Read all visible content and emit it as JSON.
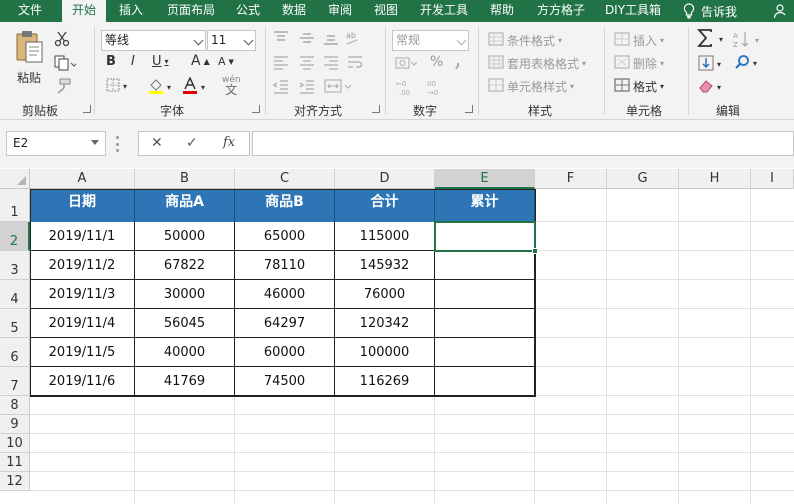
{
  "tabs": [
    "文件",
    "开始",
    "插入",
    "页面布局",
    "公式",
    "数据",
    "审阅",
    "视图",
    "开发工具",
    "帮助",
    "方方格子",
    "DIY工具箱"
  ],
  "tell_me": "告诉我",
  "ribbon": {
    "clipboard": {
      "paste": "粘贴",
      "label": "剪贴板"
    },
    "font": {
      "name": "等线",
      "size": "11",
      "bold": "B",
      "italic": "I",
      "underline": "U",
      "grow": "A",
      "shrink": "A",
      "wen": "wén",
      "wen2": "文",
      "label": "字体"
    },
    "align": {
      "label": "对齐方式"
    },
    "number": {
      "format": "常规",
      "percent": "%",
      "label": "数字"
    },
    "styles": {
      "cond": "条件格式",
      "table": "套用表格格式",
      "cell": "单元格样式",
      "label": "样式"
    },
    "cells": {
      "insert": "插入",
      "delete": "删除",
      "format": "格式",
      "label": "单元格"
    },
    "edit": {
      "label": "编辑"
    }
  },
  "formula_bar": {
    "name_box": "E2",
    "cancel": "✕",
    "enter": "✓",
    "fx": "fx",
    "formula": ""
  },
  "grid": {
    "columns": [
      "A",
      "B",
      "C",
      "D",
      "E",
      "F",
      "G",
      "H",
      "I"
    ],
    "rows": [
      "1",
      "2",
      "3",
      "4",
      "5",
      "6",
      "7",
      "8",
      "9",
      "10",
      "11",
      "12"
    ],
    "header": [
      "日期",
      "商品A",
      "商品B",
      "合计",
      "累计"
    ],
    "data": [
      [
        "2019/11/1",
        "50000",
        "65000",
        "115000",
        ""
      ],
      [
        "2019/11/2",
        "67822",
        "78110",
        "145932",
        ""
      ],
      [
        "2019/11/3",
        "30000",
        "46000",
        "76000",
        ""
      ],
      [
        "2019/11/4",
        "56045",
        "64297",
        "120342",
        ""
      ],
      [
        "2019/11/5",
        "40000",
        "60000",
        "100000",
        ""
      ],
      [
        "2019/11/6",
        "41769",
        "74500",
        "116269",
        ""
      ]
    ]
  },
  "colors": {
    "excel_green": "#217346",
    "header_blue": "#2e75b6"
  }
}
